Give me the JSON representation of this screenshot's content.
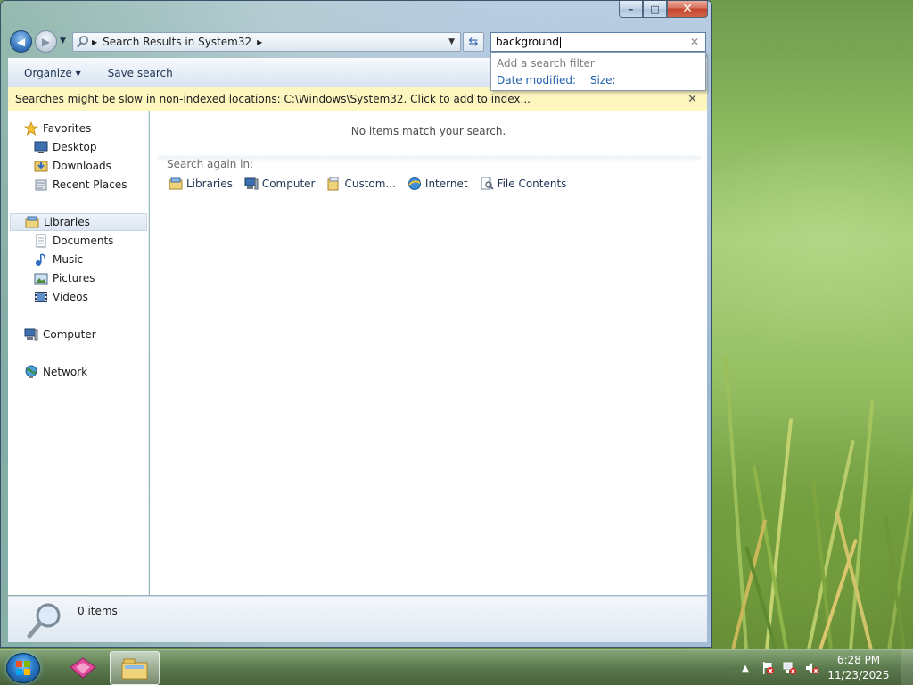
{
  "window": {
    "caption": {
      "minimize": "–",
      "maximize": "□",
      "close": "✕"
    },
    "address": {
      "segments": [
        "Search Results in System32"
      ],
      "back_glyph": "◀",
      "forward_glyph": "▶"
    },
    "search": {
      "value": "background",
      "filter_popup": {
        "heading": "Add a search filter",
        "filters": [
          "Date modified:",
          "Size:"
        ]
      }
    },
    "toolbar": {
      "organize": "Organize ▾",
      "save_search": "Save search"
    },
    "infobar": {
      "text": "Searches might be slow in non-indexed locations: C:\\Windows\\System32. Click to add to index..."
    },
    "navpane": {
      "favorites": {
        "label": "Favorites",
        "items": [
          "Desktop",
          "Downloads",
          "Recent Places"
        ]
      },
      "libraries": {
        "label": "Libraries",
        "items": [
          "Documents",
          "Music",
          "Pictures",
          "Videos"
        ]
      },
      "computer": "Computer",
      "network": "Network"
    },
    "content": {
      "empty_message": "No items match your search.",
      "search_again_label": "Search again in:",
      "search_again_targets": [
        "Libraries",
        "Computer",
        "Custom...",
        "Internet",
        "File Contents"
      ]
    },
    "details": {
      "count": "0 items"
    }
  },
  "taskbar": {
    "clock": {
      "time": "6:28 PM",
      "date": "11/23/2025"
    },
    "tray_expand": "▲"
  },
  "colors": {
    "accent": "#1f5fb0",
    "infobar": "#fdf6bf",
    "window_frame": "#9db7d3"
  }
}
